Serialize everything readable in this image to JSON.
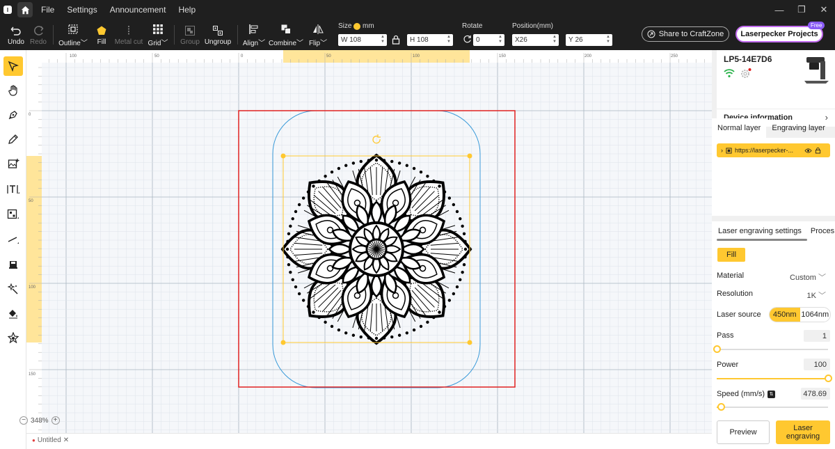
{
  "titlebar": {
    "menu": [
      "File",
      "Settings",
      "Announcement",
      "Help"
    ]
  },
  "toolbar": {
    "undo": "Undo",
    "redo": "Redo",
    "outline": "Outline",
    "fill": "Fill",
    "metal_cut": "Metal cut",
    "grid": "Grid",
    "group": "Group",
    "ungroup": "Ungroup",
    "align": "Align",
    "combine": "Combine",
    "flip": "Flip",
    "size_label": "Size",
    "unit": "mm",
    "width_prefix": "W",
    "width_value": "108",
    "height_prefix": "H",
    "height_value": "108",
    "rotate_label": "Rotate",
    "rotate_value": "0",
    "position_label": "Position(mm)",
    "x_prefix": "X",
    "x_value": "26",
    "y_prefix": "Y",
    "y_value": "26",
    "share": "Share to CraftZone",
    "projects": "Laserpecker Projects",
    "free_badge": "Free"
  },
  "canvas": {
    "ruler_top": [
      "100",
      "50",
      "0",
      "50",
      "100",
      "150",
      "200",
      "250"
    ],
    "ruler_left": [
      "0",
      "50",
      "100",
      "150"
    ],
    "zoom": "348%",
    "file_tab": "Untitled"
  },
  "device": {
    "name": "LP5-14E7D6",
    "info_label": "Device information"
  },
  "layers": {
    "tabs": [
      "Normal layer",
      "Engraving layer"
    ],
    "item": "https://laserpecker-..."
  },
  "settings": {
    "tabs": [
      "Laser engraving settings",
      "Proces"
    ],
    "mode": "Fill",
    "material_label": "Material",
    "material_value": "Custom",
    "resolution_label": "Resolution",
    "resolution_value": "1K",
    "laser_source_label": "Laser source",
    "laser_source_options": [
      "450nm",
      "1064nm"
    ],
    "pass_label": "Pass",
    "pass_value": "1",
    "pass_level": 0,
    "power_label": "Power",
    "power_value": "100",
    "power_level": 1.0,
    "speed_label": "Speed (mm/s)",
    "speed_value": "478.69",
    "speed_level": 0.04,
    "preview": "Preview",
    "engrave": "Laser engraving"
  },
  "colors": {
    "accent": "#ffc830",
    "dark": "#1f1f1f",
    "workarea_border": "#e02020",
    "selection": "#ffc830",
    "safe_area": "#3a9ad9"
  }
}
